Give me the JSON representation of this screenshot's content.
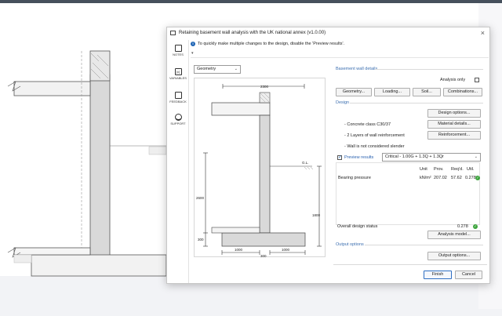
{
  "dialog": {
    "title": "Retaining basement wall analysis with the UK national annex (v1.0.00)",
    "close_symbol": "×",
    "info_text": "To quickly make multiple changes to the design, disable the 'Preview results'.",
    "collapse_caret": "▾"
  },
  "rail": {
    "notes": "NOTES",
    "variables": "VARIABLES",
    "variables_glyph": "[x]",
    "feedback": "FEEDBACK",
    "support": "SUPPORT"
  },
  "view_select": {
    "value": "Geometry",
    "caret": "⌄"
  },
  "drawing": {
    "dim_top": "2300",
    "dim_height": "2600",
    "dim_right": "1800",
    "dim_base": "300",
    "dim_heel": "1000",
    "dim_toe": "1000",
    "dim_stem": "300",
    "gl_label": "G.L."
  },
  "details": {
    "section_title": "Basement wall details",
    "analysis_only": "Analysis only",
    "buttons": [
      "Geometry...",
      "Loading...",
      "Soil...",
      "Combinations..."
    ]
  },
  "design": {
    "section_title": "Design",
    "design_options": "Design options...",
    "concrete_label": "- Concrete class C30/37",
    "material_details": "Material details...",
    "layers_label": "- 2 Layers of wall reinforcement",
    "reinforcement": "Reinforcement...",
    "slender_label": "- Wall is not considered slender"
  },
  "preview": {
    "label": "Preview results",
    "combo_value": "Critical - 1.00G + 1.3Q + 1.3Qr",
    "columns": [
      "Unit",
      "Prov.",
      "Req'd.",
      "Util."
    ],
    "rows": [
      {
        "name": "Bearing pressure",
        "unit": "kN/m²",
        "prov": "207.02",
        "reqd": "57.62",
        "util": "0.278"
      }
    ]
  },
  "overall": {
    "label": "Overall design status",
    "value": "0.278",
    "analysis_model": "Analysis model..."
  },
  "output": {
    "section_title": "Output options",
    "button": "Output options..."
  },
  "footer": {
    "finish": "Finish",
    "cancel": "Cancel"
  },
  "colors": {
    "accent": "#3c6fb0",
    "ok": "#3ca43c",
    "wall_fill": "#d9d9d9"
  }
}
